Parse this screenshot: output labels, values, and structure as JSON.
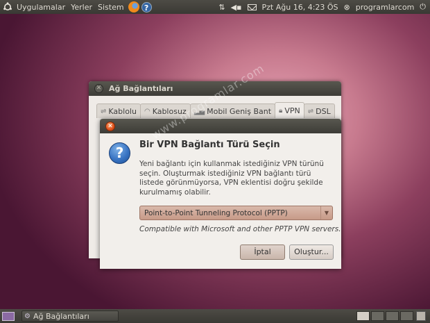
{
  "top_panel": {
    "menus": [
      "Uygulamalar",
      "Yerler",
      "Sistem"
    ],
    "datetime": "Pzt Ağu 16,  4:23 ÖS",
    "user": "programlarcom"
  },
  "bg_window": {
    "title": "Ağ Bağlantıları",
    "tabs": [
      "Kablolu",
      "Kablosuz",
      "Mobil Geniş Bant",
      "VPN",
      "DSL"
    ]
  },
  "dialog": {
    "heading": "Bir VPN Bağlantı Türü Seçin",
    "body": "Yeni bağlantı için kullanmak istediğiniz VPN türünü seçin. Oluşturmak istediğiniz VPN bağlantı türü listede görünmüyorsa, VPN eklentisi doğru şekilde kurulmamış olabilir.",
    "combo_value": "Point-to-Point Tunneling Protocol (PPTP)",
    "compat_text": "Compatible with Microsoft and other PPTP VPN servers.",
    "cancel_label": "İptal",
    "create_label": "Oluştur..."
  },
  "watermark": "www.programlar.com",
  "bottom_panel": {
    "task_label": "Ağ Bağlantıları"
  }
}
